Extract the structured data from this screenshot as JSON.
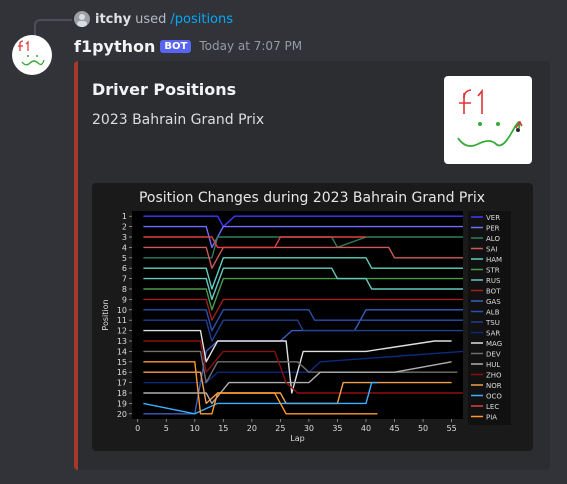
{
  "reply": {
    "username": "itchy",
    "verb": "used",
    "command": "/positions"
  },
  "message": {
    "username": "f1python",
    "badge": "BOT",
    "timestamp": "Today at 7:07 PM"
  },
  "embed": {
    "title": "Driver Positions",
    "description": "2023 Bahrain Grand Prix",
    "accent_color": "#a63a2a",
    "thumbnail_text": "f1"
  },
  "chart_data": {
    "type": "line",
    "title": "Position Changes during 2023 Bahrain Grand Prix",
    "xlabel": "Lap",
    "ylabel": "Position",
    "xlim": [
      -1,
      57
    ],
    "ylim": [
      20.5,
      0.5
    ],
    "x_ticks": [
      0,
      5,
      10,
      15,
      20,
      25,
      30,
      35,
      40,
      45,
      50,
      55
    ],
    "y_ticks": [
      1,
      2,
      3,
      4,
      5,
      6,
      7,
      8,
      9,
      10,
      11,
      12,
      13,
      14,
      15,
      16,
      17,
      18,
      19,
      20
    ],
    "grid": false,
    "legend_position": "right",
    "series": [
      {
        "name": "VER",
        "color": "#3a3aff",
        "points": [
          [
            1,
            1
          ],
          [
            14,
            1
          ],
          [
            15,
            2
          ],
          [
            17,
            1
          ],
          [
            57,
            1
          ]
        ]
      },
      {
        "name": "PER",
        "color": "#6f6fff",
        "points": [
          [
            1,
            2
          ],
          [
            12,
            2
          ],
          [
            13,
            4
          ],
          [
            15,
            2
          ],
          [
            57,
            2
          ]
        ]
      },
      {
        "name": "ALO",
        "color": "#2f7f5f",
        "points": [
          [
            1,
            5
          ],
          [
            13,
            5
          ],
          [
            14,
            3
          ],
          [
            34,
            3
          ],
          [
            35,
            4
          ],
          [
            40,
            3
          ],
          [
            57,
            3
          ]
        ]
      },
      {
        "name": "SAI",
        "color": "#d05a5a",
        "points": [
          [
            1,
            4
          ],
          [
            12,
            4
          ],
          [
            13,
            6
          ],
          [
            15,
            4
          ],
          [
            44,
            4
          ],
          [
            45,
            5
          ],
          [
            57,
            5
          ]
        ]
      },
      {
        "name": "HAM",
        "color": "#5fd0c0",
        "points": [
          [
            1,
            6
          ],
          [
            12,
            6
          ],
          [
            13,
            8
          ],
          [
            15,
            5
          ],
          [
            40,
            5
          ],
          [
            41,
            6
          ],
          [
            57,
            6
          ]
        ]
      },
      {
        "name": "STR",
        "color": "#4a9a4a",
        "points": [
          [
            1,
            8
          ],
          [
            12,
            8
          ],
          [
            13,
            10
          ],
          [
            15,
            7
          ],
          [
            57,
            7
          ]
        ]
      },
      {
        "name": "RUS",
        "color": "#64c8c0",
        "points": [
          [
            1,
            7
          ],
          [
            12,
            7
          ],
          [
            13,
            9
          ],
          [
            15,
            6
          ],
          [
            34,
            6
          ],
          [
            35,
            7
          ],
          [
            40,
            7
          ],
          [
            41,
            8
          ],
          [
            57,
            8
          ]
        ]
      },
      {
        "name": "BOT",
        "color": "#a02020",
        "points": [
          [
            1,
            9
          ],
          [
            12,
            9
          ],
          [
            13,
            11
          ],
          [
            15,
            9
          ],
          [
            57,
            9
          ]
        ]
      },
      {
        "name": "GAS",
        "color": "#3a5fc0",
        "points": [
          [
            1,
            20
          ],
          [
            10,
            20
          ],
          [
            12,
            14
          ],
          [
            14,
            13
          ],
          [
            25,
            13
          ],
          [
            27,
            12
          ],
          [
            38,
            12
          ],
          [
            40,
            10
          ],
          [
            57,
            10
          ]
        ]
      },
      {
        "name": "ALB",
        "color": "#2a50b0",
        "points": [
          [
            1,
            10
          ],
          [
            12,
            10
          ],
          [
            13,
            12
          ],
          [
            15,
            10
          ],
          [
            30,
            10
          ],
          [
            31,
            11
          ],
          [
            57,
            11
          ]
        ]
      },
      {
        "name": "TSU",
        "color": "#1f3f90",
        "points": [
          [
            1,
            11
          ],
          [
            12,
            11
          ],
          [
            13,
            13
          ],
          [
            15,
            11
          ],
          [
            28,
            11
          ],
          [
            29,
            12
          ],
          [
            57,
            12
          ]
        ]
      },
      {
        "name": "SAR",
        "color": "#0a2a80",
        "points": [
          [
            1,
            17
          ],
          [
            12,
            17
          ],
          [
            14,
            16
          ],
          [
            30,
            16
          ],
          [
            32,
            15
          ],
          [
            57,
            14
          ]
        ]
      },
      {
        "name": "MAG",
        "color": "#e0e0e0",
        "points": [
          [
            1,
            12
          ],
          [
            11,
            12
          ],
          [
            12,
            15
          ],
          [
            14,
            13
          ],
          [
            26,
            13
          ],
          [
            27,
            18
          ],
          [
            29,
            14
          ],
          [
            40,
            14
          ],
          [
            52,
            13
          ],
          [
            55,
            13
          ]
        ]
      },
      {
        "name": "DEV",
        "color": "#707070",
        "points": [
          [
            1,
            14
          ],
          [
            11,
            14
          ],
          [
            12,
            17
          ],
          [
            14,
            15
          ],
          [
            28,
            15
          ],
          [
            30,
            16
          ],
          [
            56,
            16
          ]
        ]
      },
      {
        "name": "HUL",
        "color": "#b0b0b0",
        "points": [
          [
            1,
            18
          ],
          [
            12,
            18
          ],
          [
            13,
            19
          ],
          [
            16,
            17
          ],
          [
            30,
            17
          ],
          [
            32,
            16
          ],
          [
            45,
            16
          ],
          [
            55,
            15
          ]
        ]
      },
      {
        "name": "ZHO",
        "color": "#8a1010",
        "points": [
          [
            1,
            13
          ],
          [
            11,
            13
          ],
          [
            12,
            16
          ],
          [
            15,
            14
          ],
          [
            24,
            14
          ],
          [
            26,
            17
          ],
          [
            28,
            18
          ],
          [
            57,
            18
          ]
        ]
      },
      {
        "name": "NOR",
        "color": "#f0a050",
        "points": [
          [
            1,
            16
          ],
          [
            11,
            16
          ],
          [
            12,
            19
          ],
          [
            14,
            18
          ],
          [
            25,
            18
          ],
          [
            26,
            19
          ],
          [
            35,
            19
          ],
          [
            36,
            17
          ],
          [
            55,
            17
          ]
        ]
      },
      {
        "name": "OCO",
        "color": "#3ab0ff",
        "points": [
          [
            1,
            19
          ],
          [
            10,
            20
          ],
          [
            14,
            19
          ],
          [
            40,
            19
          ],
          [
            41,
            17
          ],
          [
            42,
            17
          ]
        ]
      },
      {
        "name": "LEC",
        "color": "#e04040",
        "points": [
          [
            1,
            3
          ],
          [
            13,
            3
          ],
          [
            14,
            4
          ],
          [
            24,
            4
          ],
          [
            25,
            3
          ],
          [
            40,
            3
          ]
        ]
      },
      {
        "name": "PIA",
        "color": "#ff9a2a",
        "points": [
          [
            1,
            15
          ],
          [
            10,
            15
          ],
          [
            11,
            20
          ],
          [
            13,
            20
          ],
          [
            14,
            18
          ],
          [
            24,
            18
          ],
          [
            26,
            20
          ],
          [
            42,
            20
          ]
        ]
      }
    ]
  }
}
